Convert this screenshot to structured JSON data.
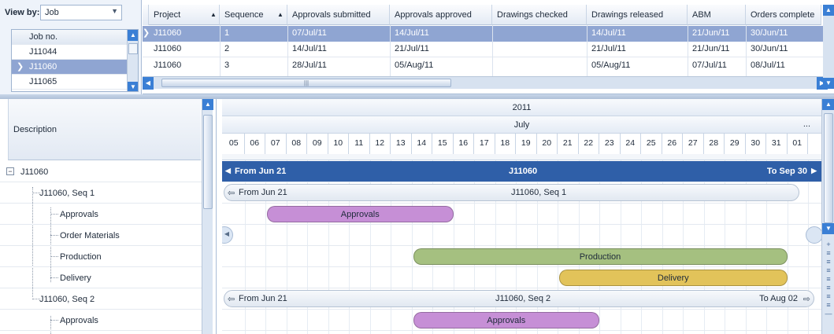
{
  "view_by": {
    "label": "View by:",
    "value": "Job"
  },
  "job_list": {
    "header": "Job no.",
    "items": [
      {
        "label": "J11044",
        "selected": false
      },
      {
        "label": "J11060",
        "selected": true
      },
      {
        "label": "J11065",
        "selected": false
      }
    ]
  },
  "top_grid": {
    "columns": [
      "Project",
      "Sequence",
      "Approvals submitted",
      "Approvals approved",
      "Drawings checked",
      "Drawings released",
      "ABM",
      "Orders complete"
    ],
    "rows": [
      {
        "selected": true,
        "cells": [
          "J11060",
          "1",
          "07/Jul/11",
          "14/Jul/11",
          "",
          "14/Jul/11",
          "21/Jun/11",
          "30/Jun/11"
        ]
      },
      {
        "selected": false,
        "cells": [
          "J11060",
          "2",
          "14/Jul/11",
          "21/Jul/11",
          "",
          "21/Jul/11",
          "21/Jun/11",
          "30/Jun/11"
        ]
      },
      {
        "selected": false,
        "cells": [
          "J11060",
          "3",
          "28/Jul/11",
          "05/Aug/11",
          "",
          "05/Aug/11",
          "07/Jul/11",
          "08/Jul/11"
        ]
      }
    ]
  },
  "tree": {
    "header": "Description",
    "rows": [
      {
        "label": "J11060",
        "kind": "root"
      },
      {
        "label": "J11060, Seq 1",
        "kind": "seq"
      },
      {
        "label": "Approvals",
        "kind": "task"
      },
      {
        "label": "Order Materials",
        "kind": "task"
      },
      {
        "label": "Production",
        "kind": "task"
      },
      {
        "label": "Delivery",
        "kind": "task"
      },
      {
        "label": "J11060, Seq 2",
        "kind": "seq"
      },
      {
        "label": "Approvals",
        "kind": "task"
      }
    ]
  },
  "gantt": {
    "year": "2011",
    "month": "July",
    "ellipsis": "...",
    "days": [
      "05",
      "06",
      "07",
      "08",
      "09",
      "10",
      "11",
      "12",
      "13",
      "14",
      "15",
      "16",
      "17",
      "18",
      "19",
      "20",
      "21",
      "22",
      "23",
      "24",
      "25",
      "26",
      "27",
      "28",
      "29",
      "30",
      "31",
      "01"
    ],
    "job_bar": {
      "from": "From Jun 21",
      "title": "J11060",
      "to": "To Sep 30"
    },
    "seq1_bar": {
      "from": "From Jun 21",
      "title": "J11060, Seq 1"
    },
    "seq2_bar": {
      "from": "From Jun 21",
      "title": "J11060, Seq 2",
      "to": "To Aug 02"
    },
    "tasks": [
      {
        "label": "Approvals",
        "row": 2,
        "start_day": "07",
        "end_day": "15",
        "color": "#c68fd6"
      },
      {
        "label": "Production",
        "row": 4,
        "start_day": "14",
        "end_day": "31",
        "color": "#a5c080"
      },
      {
        "label": "Delivery",
        "row": 5,
        "start_day": "21",
        "end_day": "31",
        "color": "#e2c35a"
      },
      {
        "label": "Approvals",
        "row": 7,
        "start_day": "14",
        "end_day": "22",
        "color": "#c68fd6"
      }
    ],
    "colors": {
      "job_bar": "#2f5fa8",
      "selection": "#8fa5d2",
      "accent": "#3a7fd5"
    }
  }
}
